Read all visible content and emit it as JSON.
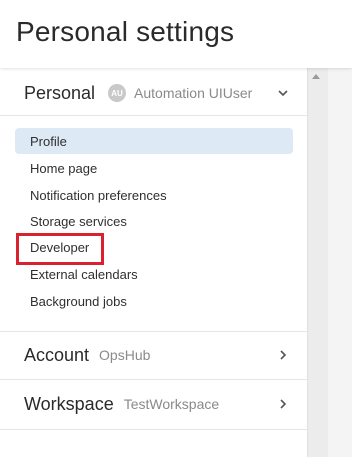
{
  "header": {
    "title": "Personal settings"
  },
  "personal": {
    "title": "Personal",
    "avatar_initials": "AU",
    "user_name": "Automation UIUser",
    "items": [
      {
        "label": "Profile",
        "active": true
      },
      {
        "label": "Home page"
      },
      {
        "label": "Notification preferences"
      },
      {
        "label": "Storage services"
      },
      {
        "label": "Developer",
        "highlighted": true
      },
      {
        "label": "External calendars"
      },
      {
        "label": "Background jobs"
      }
    ]
  },
  "account": {
    "title": "Account",
    "value": "OpsHub"
  },
  "workspace": {
    "title": "Workspace",
    "value": "TestWorkspace"
  },
  "colors": {
    "active_bg": "#dde9f5",
    "highlight": "#d9212f",
    "muted_text": "#8a8a8a"
  }
}
